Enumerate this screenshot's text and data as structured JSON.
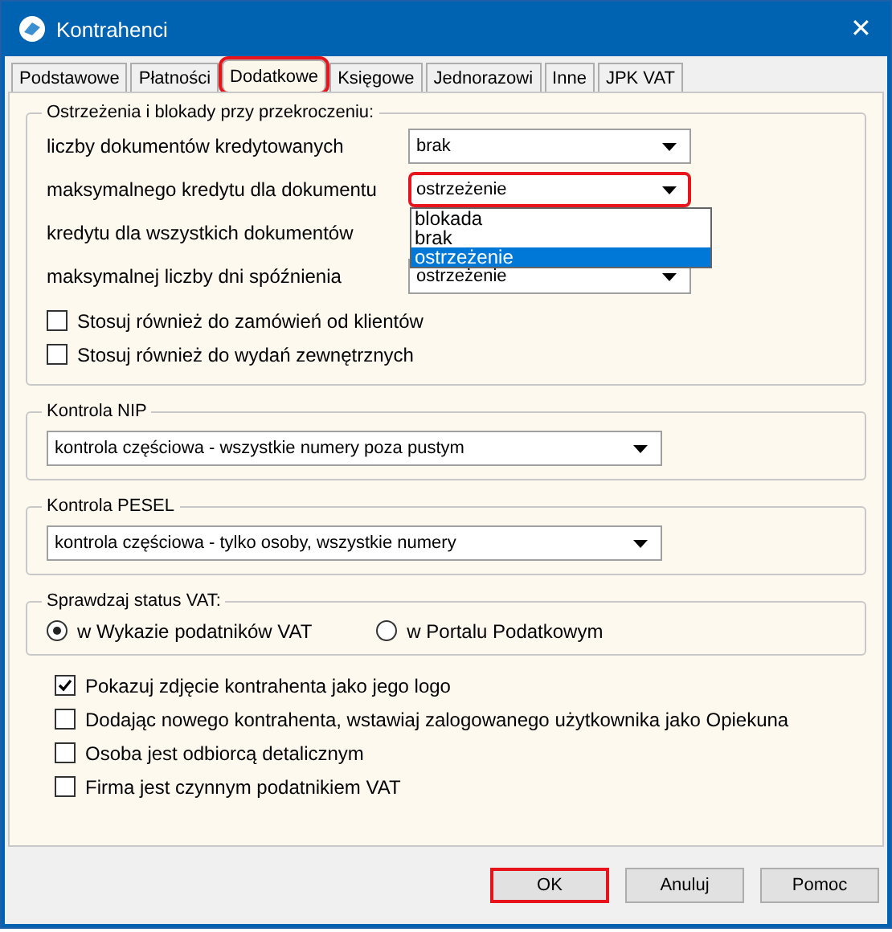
{
  "window": {
    "title": "Kontrahenci",
    "close": "✕"
  },
  "tabs": [
    {
      "label": "Podstawowe",
      "selected": false,
      "highlighted": false
    },
    {
      "label": "Płatności",
      "selected": false,
      "highlighted": false
    },
    {
      "label": "Dodatkowe",
      "selected": true,
      "highlighted": true
    },
    {
      "label": "Księgowe",
      "selected": false,
      "highlighted": false
    },
    {
      "label": "Jednorazowi",
      "selected": false,
      "highlighted": false
    },
    {
      "label": "Inne",
      "selected": false,
      "highlighted": false
    },
    {
      "label": "JPK VAT",
      "selected": false,
      "highlighted": false
    }
  ],
  "warnings": {
    "title": "Ostrzeżenia i blokady przy przekroczeniu:",
    "rows": [
      {
        "label": "liczby dokumentów kredytowanych",
        "value": "brak",
        "highlighted": false
      },
      {
        "label": "maksymalnego kredytu dla  dokumentu",
        "value": "ostrzeżenie",
        "highlighted": true,
        "options": [
          {
            "label": "blokada",
            "selected": false
          },
          {
            "label": "brak",
            "selected": false
          },
          {
            "label": "ostrzeżenie",
            "selected": true
          }
        ]
      },
      {
        "label": "kredytu dla wszystkich dokumentów"
      },
      {
        "label": "maksymalnej liczby dni spóźnienia",
        "value": "ostrzeżenie",
        "highlighted": false
      }
    ],
    "checkboxes": [
      {
        "label": "Stosuj również do zamówień od klientów",
        "checked": false
      },
      {
        "label": "Stosuj również do wydań zewnętrznych",
        "checked": false
      }
    ]
  },
  "nip": {
    "title": "Kontrola NIP",
    "value": "kontrola częściowa - wszystkie numery poza pustym"
  },
  "pesel": {
    "title": "Kontrola PESEL",
    "value": "kontrola częściowa - tylko osoby, wszystkie numery"
  },
  "vat_status": {
    "title": "Sprawdzaj status VAT:",
    "options": [
      {
        "label": "w Wykazie podatników VAT",
        "selected": true
      },
      {
        "label": "w Portalu Podatkowym",
        "selected": false
      }
    ]
  },
  "options": [
    {
      "label": "Pokazuj zdjęcie kontrahenta jako jego logo",
      "checked": true
    },
    {
      "label": "Dodając nowego kontrahenta, wstawiaj zalogowanego użytkownika jako Opiekuna",
      "checked": false
    },
    {
      "label": "Osoba jest odbiorcą detalicznym",
      "checked": false
    },
    {
      "label": "Firma jest czynnym podatnikiem VAT",
      "checked": false
    }
  ],
  "buttons": [
    {
      "label": "OK",
      "highlighted": true
    },
    {
      "label": "Anuluj",
      "highlighted": false
    },
    {
      "label": "Pomoc",
      "highlighted": false
    }
  ]
}
